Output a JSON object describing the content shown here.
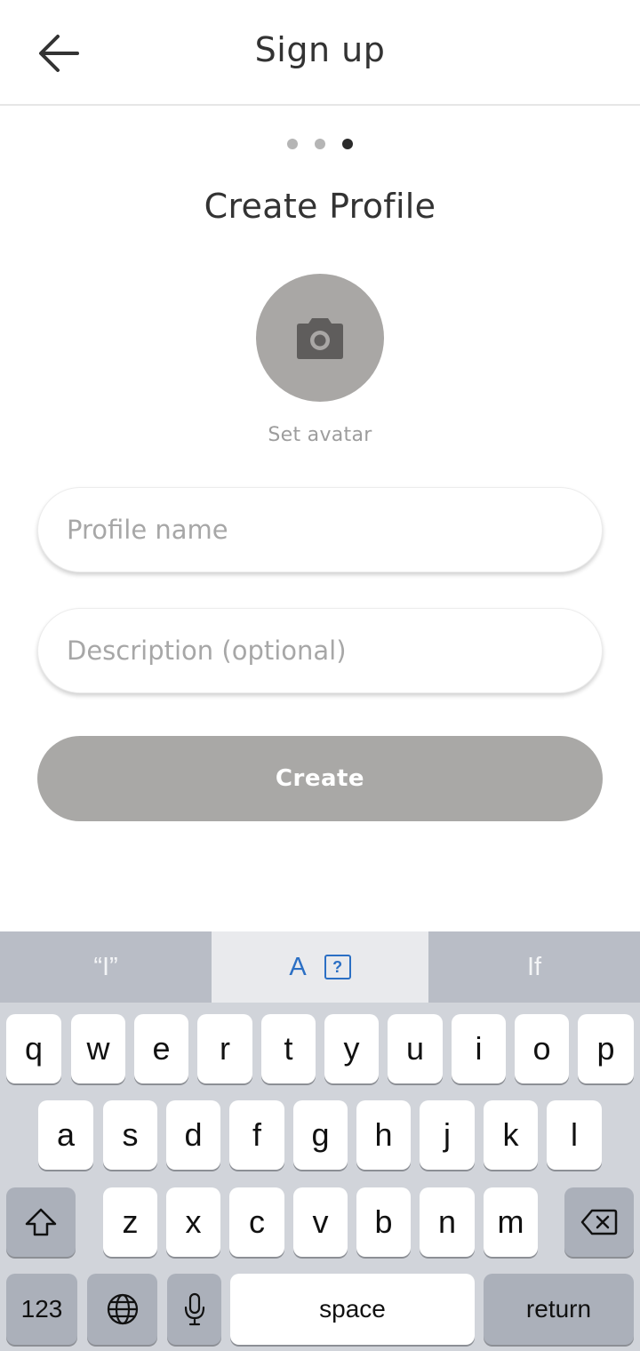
{
  "header": {
    "title": "Sign up",
    "back_icon": "arrow-left-icon"
  },
  "steps": {
    "total": 3,
    "current": 3
  },
  "profile": {
    "section_title": "Create Profile",
    "avatar_icon": "camera-icon",
    "avatar_label": "Set avatar",
    "name_placeholder": "Profile name",
    "description_placeholder": "Description (optional)",
    "create_label": "Create"
  },
  "keyboard": {
    "suggestions": {
      "left": "“I”",
      "middle": "A",
      "right": "If"
    },
    "row1": [
      "q",
      "w",
      "e",
      "r",
      "t",
      "y",
      "u",
      "i",
      "o",
      "p"
    ],
    "row2": [
      "a",
      "s",
      "d",
      "f",
      "g",
      "h",
      "j",
      "k",
      "l"
    ],
    "row3": [
      "z",
      "x",
      "c",
      "v",
      "b",
      "n",
      "m"
    ],
    "numbers_label": "123",
    "space_label": "space",
    "return_label": "return"
  }
}
